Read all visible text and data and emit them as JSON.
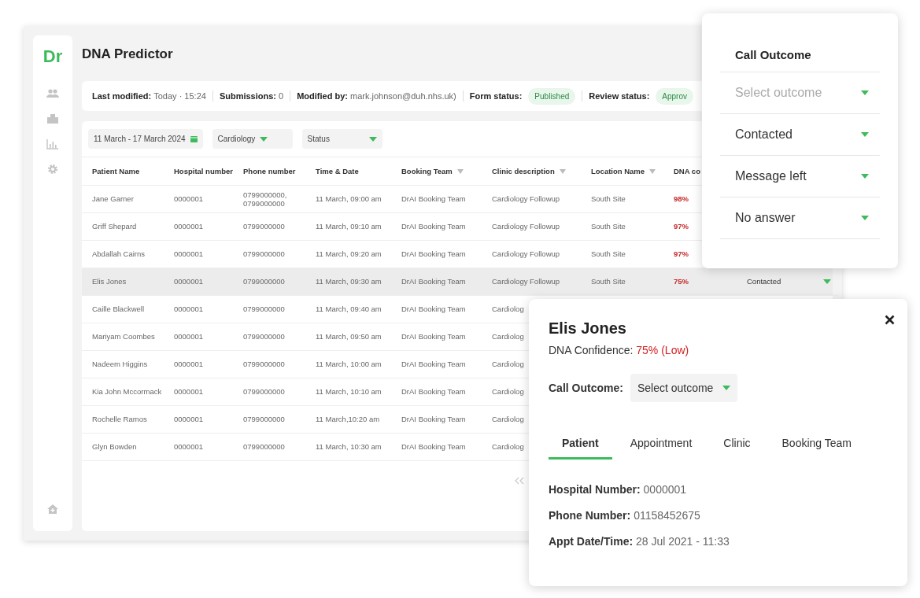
{
  "logo": "Dr",
  "title": "DNA Predictor",
  "info_bar": [
    {
      "label": "Last modified:",
      "value": "Today · 15:24"
    },
    {
      "label": "Submissions:",
      "value": "0"
    },
    {
      "label": "Modified by:",
      "value": "mark.johnson@duh.nhs.uk)"
    },
    {
      "label": "Form status:",
      "badge": "Published"
    },
    {
      "label": "Review status:",
      "badge": "Approv"
    }
  ],
  "filters": [
    {
      "kind": "date",
      "value": "11 March - 17 March 2024"
    },
    {
      "kind": "select",
      "value": "Cardiology"
    },
    {
      "kind": "select",
      "value": "Status"
    }
  ],
  "table": {
    "columns": [
      {
        "label": "Patient Name",
        "sortable": false
      },
      {
        "label": "Hospital number",
        "sortable": false
      },
      {
        "label": "Phone number",
        "sortable": false
      },
      {
        "label": "Time & Date",
        "sortable": false
      },
      {
        "label": "Booking Team",
        "sortable": true
      },
      {
        "label": "Clinic description",
        "sortable": true
      },
      {
        "label": "Location Name",
        "sortable": true
      },
      {
        "label": "DNA co"
      }
    ],
    "rows": [
      {
        "selected": false,
        "cells": [
          "Jane Garner",
          "0000001",
          "0799000000, 0799000000",
          "11 March, 09:00 am",
          "DrAI Booking Team",
          "Cardiology Followup",
          "South Site",
          "98%"
        ]
      },
      {
        "selected": false,
        "cells": [
          "Griff Shepard",
          "0000001",
          "0799000000",
          "11 March, 09:10 am",
          "DrAI Booking Team",
          "Cardiology Followup",
          "South Site",
          "97%"
        ]
      },
      {
        "selected": false,
        "cells": [
          "Abdallah Cairns",
          "0000001",
          "0799000000",
          "11 March, 09:20 am",
          "DrAI Booking Team",
          "Cardiology Followup",
          "South Site",
          "97%"
        ]
      },
      {
        "selected": true,
        "cells": [
          "Elis Jones",
          "0000001",
          "0799000000",
          "11 March, 09:30 am",
          "DrAI Booking Team",
          "Cardiology Followup",
          "South Site",
          "75%"
        ],
        "outcome": "Contacted"
      },
      {
        "selected": false,
        "cells": [
          "Caille Blackwell",
          "0000001",
          "0799000000",
          "11 March, 09:40 am",
          "DrAI Booking Team",
          "Cardiolog"
        ]
      },
      {
        "selected": false,
        "cells": [
          "Mariyam Coombes",
          "0000001",
          "0799000000",
          "11 March, 09:50 am",
          "DrAI Booking Team",
          "Cardiolog"
        ]
      },
      {
        "selected": false,
        "cells": [
          "Nadeem Higgins",
          "0000001",
          "0799000000",
          "11 March, 10:00 am",
          "DrAI Booking Team",
          "Cardiolog"
        ]
      },
      {
        "selected": false,
        "cells": [
          "Kia John Mccormack",
          "0000001",
          "0799000000",
          "11 March, 10:10 am",
          "DrAI Booking Team",
          "Cardiolog"
        ]
      },
      {
        "selected": false,
        "cells": [
          "Rochelle Ramos",
          "0000001",
          "0799000000",
          "11 March,10:20 am",
          "DrAI Booking Team",
          "Cardiolog"
        ]
      },
      {
        "selected": false,
        "cells": [
          "Glyn Bowden",
          "0000001",
          "0799000000",
          "11 March, 10:30 am",
          "DrAI Booking Team",
          "Cardiolog"
        ]
      }
    ]
  },
  "outcome_menu": {
    "title": "Call Outcome",
    "options": [
      {
        "label": "Select outcome",
        "placeholder": true
      },
      {
        "label": "Contacted",
        "placeholder": false
      },
      {
        "label": "Message left",
        "placeholder": false
      },
      {
        "label": "No answer",
        "placeholder": false
      }
    ]
  },
  "details": {
    "name": "Elis Jones",
    "confidence_label": "DNA Confidence:",
    "confidence_value": "75% (Low)",
    "outcome_label": "Call Outcome:",
    "outcome_select": "Select outcome",
    "tabs": [
      {
        "label": "Patient",
        "selected": true
      },
      {
        "label": "Appointment",
        "selected": false
      },
      {
        "label": "Clinic",
        "selected": false
      },
      {
        "label": "Booking Team",
        "selected": false
      }
    ],
    "fields": [
      {
        "label": "Hospital Number:",
        "value": "0000001"
      },
      {
        "label": "Phone Number:",
        "value": "01158452675"
      },
      {
        "label": "Appt Date/Time:",
        "value": "28 Jul 2021 - 11:33"
      }
    ]
  }
}
